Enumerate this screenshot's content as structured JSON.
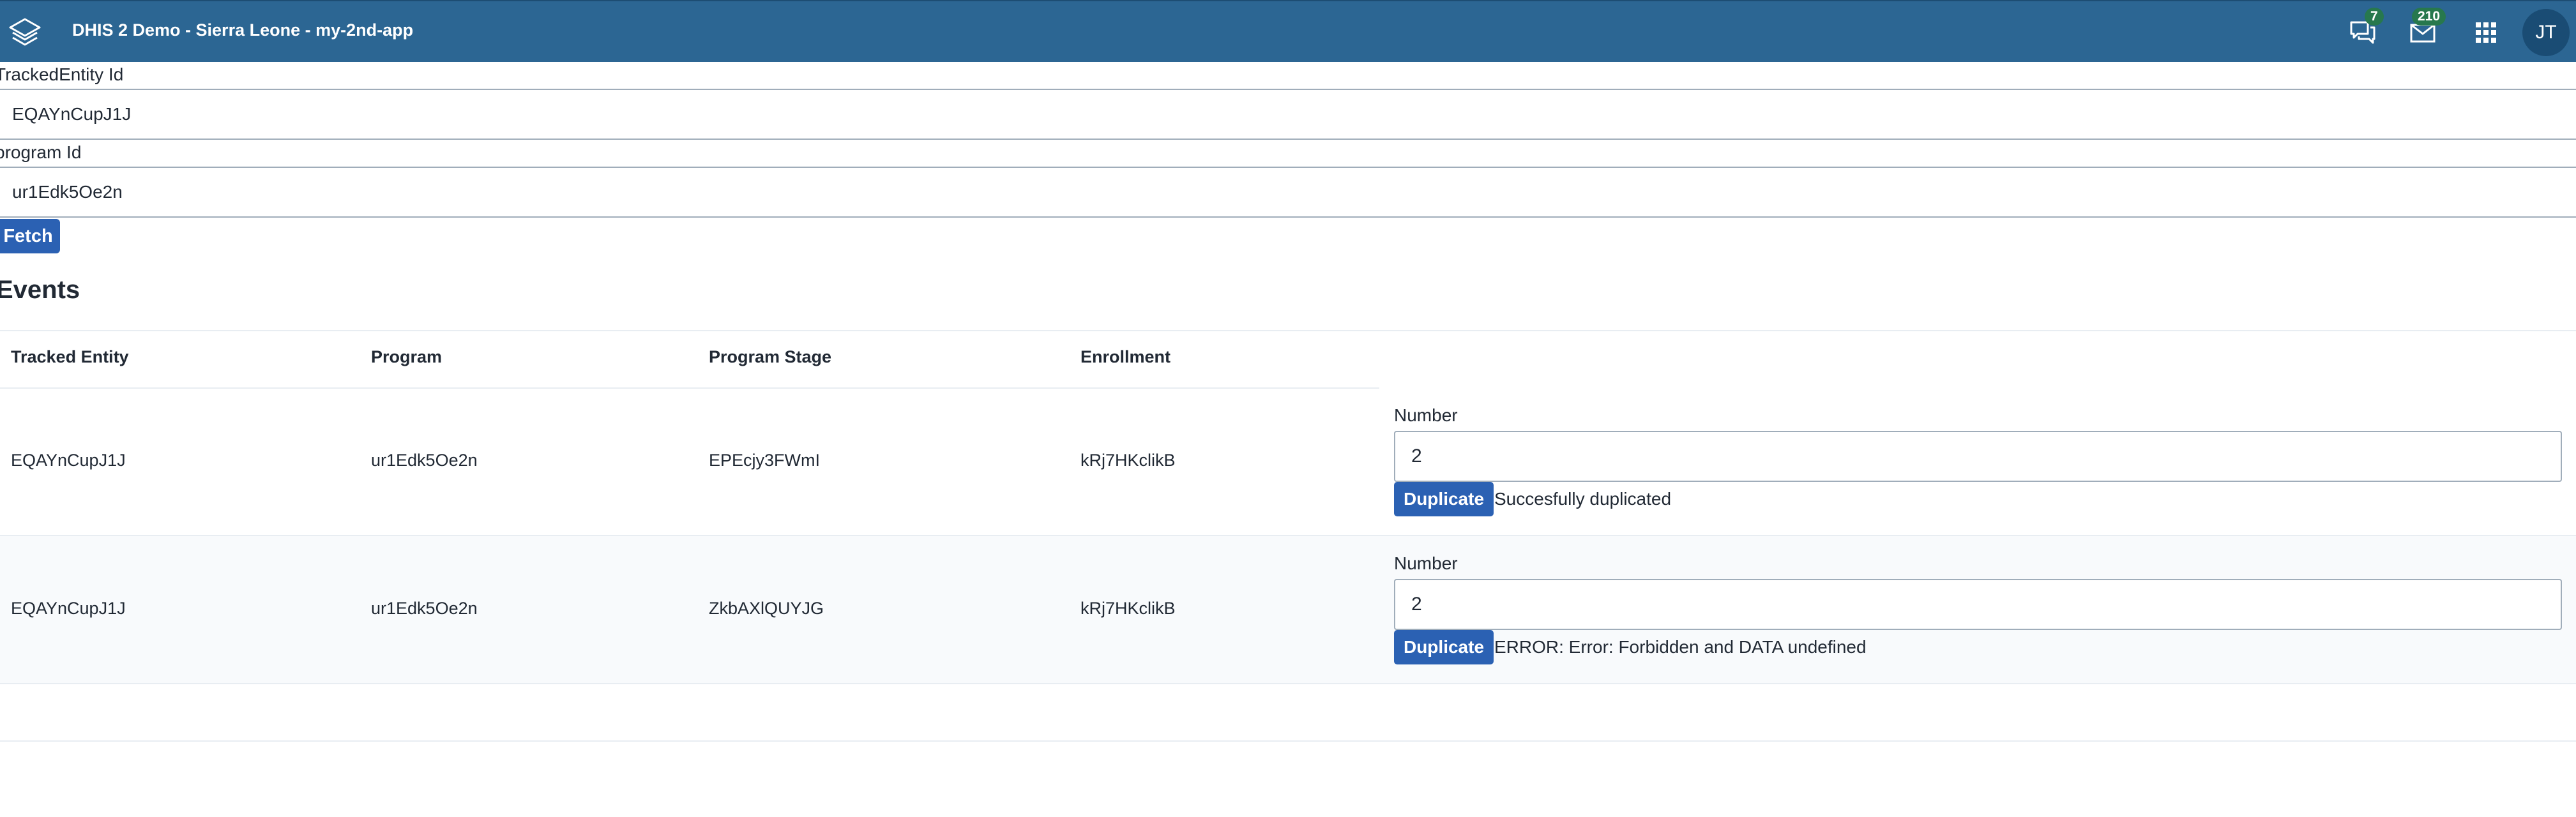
{
  "header": {
    "title": "DHIS 2 Demo - Sierra Leone - my-2nd-app",
    "interpretations_count": "7",
    "messages_count": "210",
    "user_initials": "JT",
    "background_color": "#2c6693",
    "badge_color": "#27784d",
    "icons": [
      "dhis2-logo-icon",
      "interpretations-icon",
      "messages-icon",
      "apps-grid-icon"
    ]
  },
  "form": {
    "tracked_entity_label": "TrackedEntity Id",
    "tracked_entity_value": "EQAYnCupJ1J",
    "program_label": "program Id",
    "program_value": "ur1Edk5Oe2n",
    "fetch_label": "Fetch"
  },
  "events": {
    "heading": "Events",
    "columns": [
      "Tracked Entity",
      "Program",
      "Program Stage",
      "Enrollment"
    ],
    "rows": [
      {
        "tracked_entity": "EQAYnCupJ1J",
        "program": "ur1Edk5Oe2n",
        "program_stage": "EPEcjy3FWmI",
        "enrollment": "kRj7HKclikB",
        "number_label": "Number",
        "number_value": "2",
        "duplicate_label": "Duplicate",
        "status": "Succesfully duplicated"
      },
      {
        "tracked_entity": "EQAYnCupJ1J",
        "program": "ur1Edk5Oe2n",
        "program_stage": "ZkbAXlQUYJG",
        "enrollment": "kRj7HKclikB",
        "number_label": "Number",
        "number_value": "2",
        "duplicate_label": "Duplicate",
        "status": "ERROR: Error: Forbidden and DATA undefined"
      }
    ]
  },
  "colors": {
    "primary_button": "#2b61b3",
    "row_alt": "#f8fafc"
  }
}
